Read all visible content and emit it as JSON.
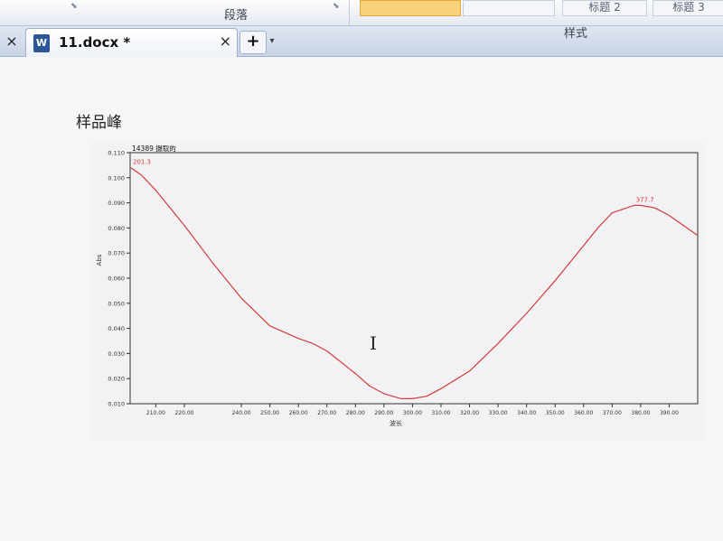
{
  "ribbon": {
    "paragraph_label": "段落",
    "styles": [
      "标题 2",
      "标题 3"
    ]
  },
  "tabs": {
    "close_left": "×",
    "document_tab_label": "11.docx *",
    "document_icon_letter": "W",
    "document_close": "×",
    "new_tab": "+",
    "new_tab_dropdown": "▾",
    "styles_group_label": "样式"
  },
  "document": {
    "heading": "样品峰"
  },
  "chart_data": {
    "type": "line",
    "title": "14389 摄取的",
    "xlabel": "波长",
    "ylabel": "Abs",
    "xlim": [
      201,
      400
    ],
    "ylim": [
      0.01,
      0.11
    ],
    "xticks": [
      "210.00",
      "220.00",
      "240.00",
      "250.00",
      "260.00",
      "270.00",
      "280.00",
      "290.00",
      "300.00",
      "310.00",
      "320.00",
      "330.00",
      "340.00",
      "350.00",
      "360.00",
      "370.00",
      "380.00",
      "390.00"
    ],
    "yticks": [
      "0.010",
      "0.020",
      "0.030",
      "0.040",
      "0.050",
      "0.060",
      "0.070",
      "0.080",
      "0.090",
      "0.100",
      "0.110"
    ],
    "line_color": "#d33b3b",
    "series": [
      {
        "x": [
          201.3,
          205,
          210,
          220,
          230,
          240,
          250,
          260,
          265,
          270,
          280,
          285,
          290,
          296,
          300,
          305,
          310,
          320,
          330,
          340,
          350,
          360,
          365,
          370,
          377.7,
          380,
          385,
          390,
          395,
          400
        ],
        "values": [
          0.104,
          0.101,
          0.095,
          0.081,
          0.066,
          0.052,
          0.041,
          0.036,
          0.034,
          0.031,
          0.022,
          0.017,
          0.014,
          0.012,
          0.012,
          0.013,
          0.016,
          0.023,
          0.034,
          0.046,
          0.059,
          0.073,
          0.08,
          0.086,
          0.089,
          0.089,
          0.088,
          0.085,
          0.081,
          0.077
        ]
      }
    ],
    "peak_labels": [
      {
        "x": 201.3,
        "y": 0.104,
        "label": "201.3"
      },
      {
        "x": 377.7,
        "y": 0.089,
        "label": "377.7"
      }
    ],
    "grid": false
  }
}
